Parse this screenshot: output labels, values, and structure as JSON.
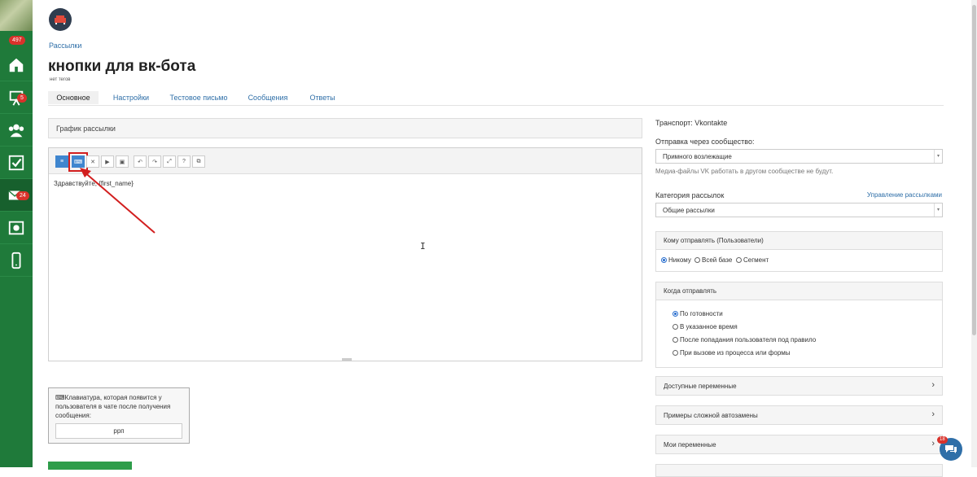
{
  "sidebar": {
    "badges": {
      "top": "497",
      "tasks": "5",
      "mail": "24"
    },
    "items": [
      "home-icon",
      "presentation-icon",
      "users-icon",
      "checkbox-icon",
      "mail-icon",
      "money-icon",
      "phone-icon"
    ]
  },
  "breadcrumb": "Рассылки",
  "title": "кнопки для вк-бота",
  "tags": "нет тегов",
  "tabs": [
    "Основное",
    "Настройки",
    "Тестовое письмо",
    "Сообщения",
    "Ответы"
  ],
  "schedule_panel": "График рассылки",
  "editor": {
    "toolbar_icons": [
      "text-icon",
      "keyboard-icon",
      "close-icon",
      "video-icon",
      "image-icon",
      "undo-icon",
      "redo-icon",
      "fullscreen-icon",
      "help-icon",
      "copy-icon"
    ],
    "content": "Здравствуйте, {first_name}"
  },
  "keyboard": {
    "label": "⌨Клавиатура, которая появится у пользователя в чате после получения сообщения:",
    "value": "ррп"
  },
  "right": {
    "transport": "Транспорт: Vkontakte",
    "via_label": "Отправка через сообщество:",
    "via_value": "Примного возлежащие",
    "media_note": "Медиа-файлы VK работать в другом сообществе не будут.",
    "category_label": "Категория рассылок",
    "manage_link": "Управление рассылками",
    "category_value": "Общие рассылки",
    "recipients_head": "Кому отправлять (Пользователи)",
    "recipients": [
      "Никому",
      "Всей базе",
      "Сегмент"
    ],
    "when_head": "Когда отправлять",
    "when_options": [
      "По готовности",
      "В указанное время",
      "После попадания пользователя под правило",
      "При вызове из процесса или формы"
    ],
    "collapsibles": [
      "Доступные переменные",
      "Примеры сложной автозамены",
      "Мои переменные"
    ]
  },
  "chat_badge": "18",
  "colors": {
    "sidebar": "#1f7a3a",
    "link": "#2f6fa8",
    "accent": "#3f86cf",
    "highlight": "#d21f1f"
  }
}
